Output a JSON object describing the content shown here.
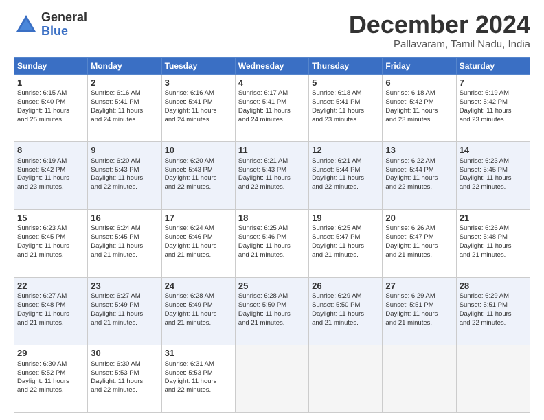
{
  "logo": {
    "general": "General",
    "blue": "Blue"
  },
  "title": "December 2024",
  "location": "Pallavaram, Tamil Nadu, India",
  "weekdays": [
    "Sunday",
    "Monday",
    "Tuesday",
    "Wednesday",
    "Thursday",
    "Friday",
    "Saturday"
  ],
  "weeks": [
    [
      {
        "day": "1",
        "info": "Sunrise: 6:15 AM\nSunset: 5:40 PM\nDaylight: 11 hours\nand 25 minutes."
      },
      {
        "day": "2",
        "info": "Sunrise: 6:16 AM\nSunset: 5:41 PM\nDaylight: 11 hours\nand 24 minutes."
      },
      {
        "day": "3",
        "info": "Sunrise: 6:16 AM\nSunset: 5:41 PM\nDaylight: 11 hours\nand 24 minutes."
      },
      {
        "day": "4",
        "info": "Sunrise: 6:17 AM\nSunset: 5:41 PM\nDaylight: 11 hours\nand 24 minutes."
      },
      {
        "day": "5",
        "info": "Sunrise: 6:18 AM\nSunset: 5:41 PM\nDaylight: 11 hours\nand 23 minutes."
      },
      {
        "day": "6",
        "info": "Sunrise: 6:18 AM\nSunset: 5:42 PM\nDaylight: 11 hours\nand 23 minutes."
      },
      {
        "day": "7",
        "info": "Sunrise: 6:19 AM\nSunset: 5:42 PM\nDaylight: 11 hours\nand 23 minutes."
      }
    ],
    [
      {
        "day": "8",
        "info": "Sunrise: 6:19 AM\nSunset: 5:42 PM\nDaylight: 11 hours\nand 23 minutes."
      },
      {
        "day": "9",
        "info": "Sunrise: 6:20 AM\nSunset: 5:43 PM\nDaylight: 11 hours\nand 22 minutes."
      },
      {
        "day": "10",
        "info": "Sunrise: 6:20 AM\nSunset: 5:43 PM\nDaylight: 11 hours\nand 22 minutes."
      },
      {
        "day": "11",
        "info": "Sunrise: 6:21 AM\nSunset: 5:43 PM\nDaylight: 11 hours\nand 22 minutes."
      },
      {
        "day": "12",
        "info": "Sunrise: 6:21 AM\nSunset: 5:44 PM\nDaylight: 11 hours\nand 22 minutes."
      },
      {
        "day": "13",
        "info": "Sunrise: 6:22 AM\nSunset: 5:44 PM\nDaylight: 11 hours\nand 22 minutes."
      },
      {
        "day": "14",
        "info": "Sunrise: 6:23 AM\nSunset: 5:45 PM\nDaylight: 11 hours\nand 22 minutes."
      }
    ],
    [
      {
        "day": "15",
        "info": "Sunrise: 6:23 AM\nSunset: 5:45 PM\nDaylight: 11 hours\nand 21 minutes."
      },
      {
        "day": "16",
        "info": "Sunrise: 6:24 AM\nSunset: 5:45 PM\nDaylight: 11 hours\nand 21 minutes."
      },
      {
        "day": "17",
        "info": "Sunrise: 6:24 AM\nSunset: 5:46 PM\nDaylight: 11 hours\nand 21 minutes."
      },
      {
        "day": "18",
        "info": "Sunrise: 6:25 AM\nSunset: 5:46 PM\nDaylight: 11 hours\nand 21 minutes."
      },
      {
        "day": "19",
        "info": "Sunrise: 6:25 AM\nSunset: 5:47 PM\nDaylight: 11 hours\nand 21 minutes."
      },
      {
        "day": "20",
        "info": "Sunrise: 6:26 AM\nSunset: 5:47 PM\nDaylight: 11 hours\nand 21 minutes."
      },
      {
        "day": "21",
        "info": "Sunrise: 6:26 AM\nSunset: 5:48 PM\nDaylight: 11 hours\nand 21 minutes."
      }
    ],
    [
      {
        "day": "22",
        "info": "Sunrise: 6:27 AM\nSunset: 5:48 PM\nDaylight: 11 hours\nand 21 minutes."
      },
      {
        "day": "23",
        "info": "Sunrise: 6:27 AM\nSunset: 5:49 PM\nDaylight: 11 hours\nand 21 minutes."
      },
      {
        "day": "24",
        "info": "Sunrise: 6:28 AM\nSunset: 5:49 PM\nDaylight: 11 hours\nand 21 minutes."
      },
      {
        "day": "25",
        "info": "Sunrise: 6:28 AM\nSunset: 5:50 PM\nDaylight: 11 hours\nand 21 minutes."
      },
      {
        "day": "26",
        "info": "Sunrise: 6:29 AM\nSunset: 5:50 PM\nDaylight: 11 hours\nand 21 minutes."
      },
      {
        "day": "27",
        "info": "Sunrise: 6:29 AM\nSunset: 5:51 PM\nDaylight: 11 hours\nand 21 minutes."
      },
      {
        "day": "28",
        "info": "Sunrise: 6:29 AM\nSunset: 5:51 PM\nDaylight: 11 hours\nand 22 minutes."
      }
    ],
    [
      {
        "day": "29",
        "info": "Sunrise: 6:30 AM\nSunset: 5:52 PM\nDaylight: 11 hours\nand 22 minutes."
      },
      {
        "day": "30",
        "info": "Sunrise: 6:30 AM\nSunset: 5:53 PM\nDaylight: 11 hours\nand 22 minutes."
      },
      {
        "day": "31",
        "info": "Sunrise: 6:31 AM\nSunset: 5:53 PM\nDaylight: 11 hours\nand 22 minutes."
      },
      {
        "day": "",
        "info": ""
      },
      {
        "day": "",
        "info": ""
      },
      {
        "day": "",
        "info": ""
      },
      {
        "day": "",
        "info": ""
      }
    ]
  ]
}
